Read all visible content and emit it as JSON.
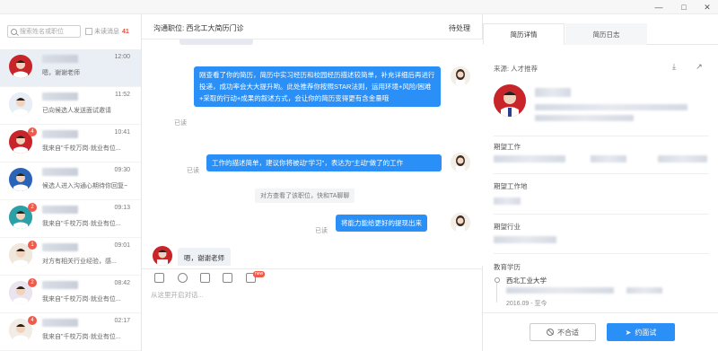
{
  "window": {
    "min_icon": "—",
    "max_icon": "□",
    "close_icon": "✕"
  },
  "sidebar": {
    "search_placeholder": "搜索姓名或职位",
    "unread_label": "未读消息",
    "unread_count": "41",
    "conversations": [
      {
        "time": "12:00",
        "preview": "嗯，谢谢老师",
        "badge": "",
        "active": true
      },
      {
        "time": "11:52",
        "preview": "已向候选人发送面试邀请",
        "badge": ""
      },
      {
        "time": "10:41",
        "preview": "我来自\"千校万岗·就业有位...",
        "badge": "4"
      },
      {
        "time": "09:30",
        "preview": "候选人进入沟通心期待你回复~",
        "badge": ""
      },
      {
        "time": "09:13",
        "preview": "我来自\"千校万岗·就业有位...",
        "badge": "2"
      },
      {
        "time": "09:01",
        "preview": "对方有相关行业经验，感...",
        "badge": "1"
      },
      {
        "time": "08:42",
        "preview": "我来自\"千校万岗·就业有位...",
        "badge": "2"
      },
      {
        "time": "02:17",
        "preview": "我来自\"千校万岗·就业有位...",
        "badge": "4"
      }
    ]
  },
  "chat": {
    "job_label": "沟通职位:  西北工大简历门诊",
    "status": "待处理",
    "messages": {
      "msg1": "刚查看了你的简历，简历中实习经历和校园经历描述较简单，补充详细后再进行投递，成功率会大大提升哟。此处推荐你按照STAR法则，运用环境+风险/困难+采取的行动+成果的叙述方式，会让你的简历变得更有含金量哦",
      "msg2": "工作的描述简单，建议你将被动\"学习\"，表达为\"主动\"做了的工作",
      "sys": "对方查看了该职位，快和TA聊聊",
      "msg3": "将能力能给更好的提现出来",
      "msg4": "嗯，谢谢老师"
    },
    "read_label": "已读",
    "input_placeholder": "从这里开启对话...",
    "new_tag": "new"
  },
  "profile": {
    "tab_detail": "简历详情",
    "tab_log": "简历日志",
    "source": "来源:  人才推荐",
    "sections": {
      "expected_job": "期望工作",
      "expected_location": "期望工作地",
      "expected_industry": "期望行业",
      "education": "教育学历"
    },
    "school": "西北工业大学",
    "period": "2016.09 - 至今",
    "unfit_button": "不合适",
    "interview_button": "约面试"
  },
  "colors": {
    "accent": "#2a8ff7",
    "badge": "#f05a4a"
  }
}
